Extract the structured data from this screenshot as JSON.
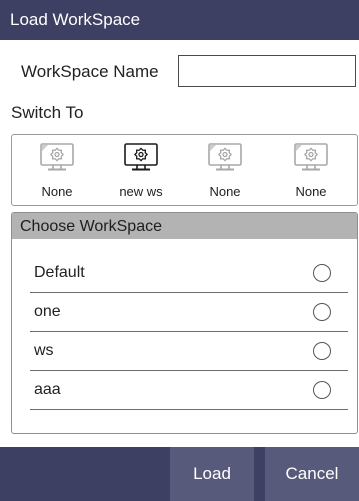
{
  "dialog": {
    "title": "Load WorkSpace",
    "name_label": "WorkSpace Name",
    "name_value": "",
    "switch_label": "Switch To",
    "slots": [
      {
        "label": "None",
        "active": false
      },
      {
        "label": "new ws",
        "active": true
      },
      {
        "label": "None",
        "active": false
      },
      {
        "label": "None",
        "active": false
      }
    ],
    "choose": {
      "header": "Choose WorkSpace",
      "items": [
        {
          "label": "Default",
          "selected": false
        },
        {
          "label": "one",
          "selected": false
        },
        {
          "label": "ws",
          "selected": false
        },
        {
          "label": "aaa",
          "selected": false
        }
      ]
    },
    "buttons": {
      "load": "Load",
      "cancel": "Cancel"
    }
  },
  "colors": {
    "titlebar": "#3d3f63",
    "button": "#585a7c",
    "icon_active": "#1a1a1a",
    "icon_inactive": "#a8a8a8"
  },
  "icons": {
    "slot_icon": "monitor-gear-icon"
  }
}
